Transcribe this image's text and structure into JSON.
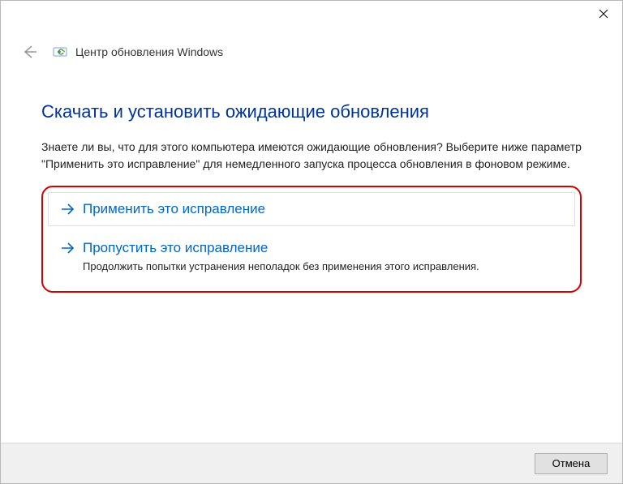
{
  "titlebar": {},
  "header": {
    "app_title": "Центр обновления Windows"
  },
  "main": {
    "heading": "Скачать и установить ожидающие обновления",
    "description": "Знаете ли вы, что для этого компьютера имеются ожидающие обновления? Выберите ниже параметр \"Применить это исправление\" для немедленного запуска процесса обновления в фоновом режиме.",
    "options": [
      {
        "label": "Применить это исправление",
        "sub": ""
      },
      {
        "label": "Пропустить это исправление",
        "sub": "Продолжить попытки устранения неполадок без применения этого исправления."
      }
    ]
  },
  "footer": {
    "cancel_label": "Отмена"
  }
}
